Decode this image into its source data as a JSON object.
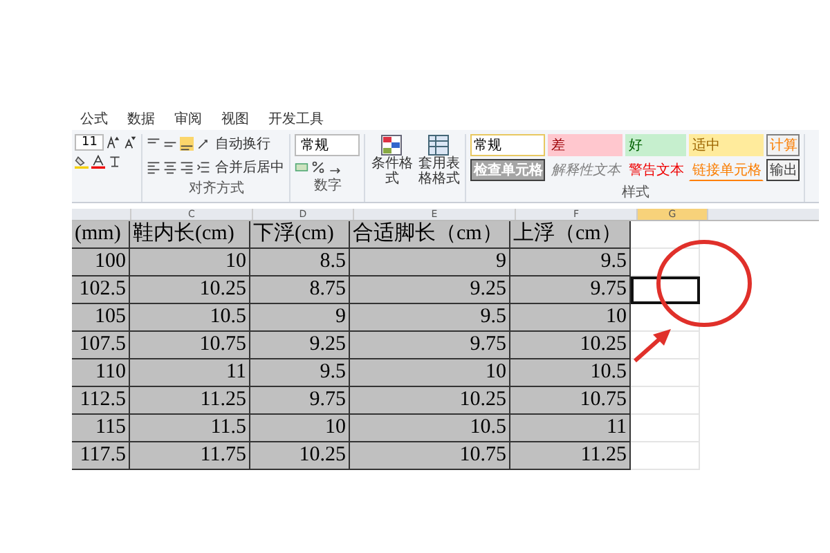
{
  "ribbon": {
    "tabs": [
      "公式",
      "数据",
      "审阅",
      "视图",
      "开发工具"
    ],
    "font_size": "11",
    "wrap_text": "自动换行",
    "merge_center": "合并后居中",
    "alignment_group": "对齐方式",
    "number_format": "常规",
    "number_group": "数字",
    "conditional_format": "条件格式",
    "table_format": "套用表格格式",
    "styles": [
      {
        "label": "常规",
        "kind": "normal"
      },
      {
        "label": "差",
        "kind": "bad"
      },
      {
        "label": "好",
        "kind": "good"
      },
      {
        "label": "适中",
        "kind": "neutral"
      },
      {
        "label": "计算",
        "kind": "calculation"
      },
      {
        "label": "检查单元格",
        "kind": "check"
      },
      {
        "label": "解释性文本",
        "kind": "explanatory"
      },
      {
        "label": "警告文本",
        "kind": "warning"
      },
      {
        "label": "链接单元格",
        "kind": "linked"
      },
      {
        "label": "输出",
        "kind": "output"
      }
    ],
    "styles_group": "样式"
  },
  "sheet": {
    "column_letters": [
      "C",
      "D",
      "E",
      "F",
      "G"
    ],
    "headers": [
      "(mm)",
      "鞋内长(cm)",
      "下浮(cm)",
      "合适脚长（cm）",
      "上浮（cm）"
    ],
    "rows": [
      {
        "cells": [
          "100",
          "10",
          "8.5",
          "9",
          "9.5"
        ],
        "blank_selected": false
      },
      {
        "cells": [
          "102.5",
          "10.25",
          "8.75",
          "9.25",
          "9.75"
        ],
        "blank_selected": true
      },
      {
        "cells": [
          "105",
          "10.5",
          "9",
          "9.5",
          "10"
        ],
        "blank_selected": false
      },
      {
        "cells": [
          "107.5",
          "10.75",
          "9.25",
          "9.75",
          "10.25"
        ],
        "blank_selected": false
      },
      {
        "cells": [
          "110",
          "11",
          "9.5",
          "10",
          "10.5"
        ],
        "blank_selected": false
      },
      {
        "cells": [
          "112.5",
          "11.25",
          "9.75",
          "10.25",
          "10.75"
        ],
        "blank_selected": false
      },
      {
        "cells": [
          "115",
          "11.5",
          "10",
          "10.5",
          "11"
        ],
        "blank_selected": false
      },
      {
        "cells": [
          "117.5",
          "11.75",
          "10.25",
          "10.75",
          "11.25"
        ],
        "blank_selected": false
      }
    ]
  }
}
